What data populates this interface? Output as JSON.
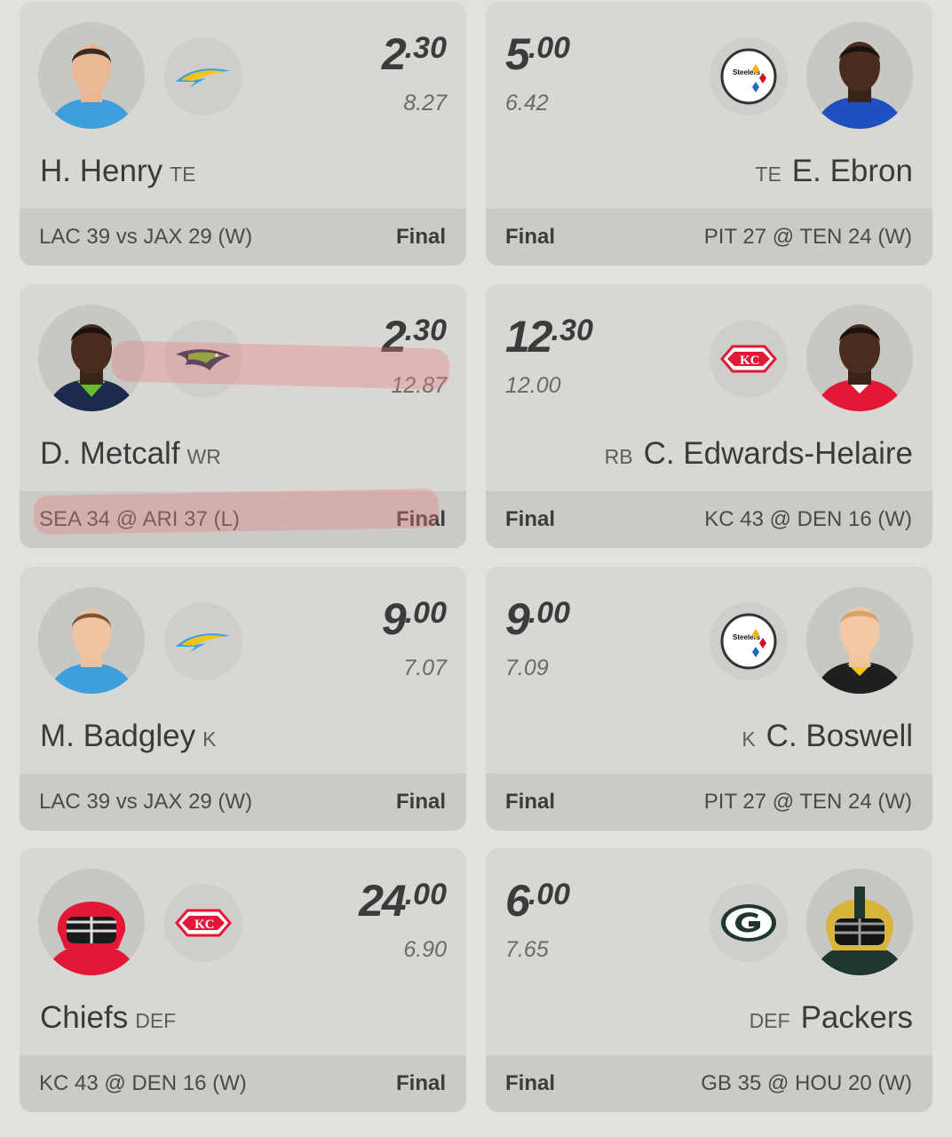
{
  "cards": [
    {
      "points_int": "2",
      "points_dec": ".30",
      "projection": "8.27",
      "name": "H. Henry",
      "position": "TE",
      "result": "LAC 39 vs JAX 29 (W)",
      "status": "Final",
      "team_logo": "chargers-logo",
      "avatar": "player-photo"
    },
    {
      "points_int": "5",
      "points_dec": ".00",
      "projection": "6.42",
      "name": "E. Ebron",
      "position": "TE",
      "result": "PIT 27 @ TEN 24 (W)",
      "status": "Final",
      "team_logo": "steelers-logo",
      "avatar": "player-photo"
    },
    {
      "points_int": "2",
      "points_dec": ".30",
      "projection": "12.87",
      "name": "D. Metcalf",
      "position": "WR",
      "result": "SEA 34 @ ARI 37 (L)",
      "status": "Final",
      "team_logo": "seahawks-logo",
      "avatar": "player-photo"
    },
    {
      "points_int": "12",
      "points_dec": ".30",
      "projection": "12.00",
      "name": "C. Edwards-Helaire",
      "position": "RB",
      "result": "KC 43 @ DEN 16 (W)",
      "status": "Final",
      "team_logo": "chiefs-logo",
      "avatar": "player-photo"
    },
    {
      "points_int": "9",
      "points_dec": ".00",
      "projection": "7.07",
      "name": "M. Badgley",
      "position": "K",
      "result": "LAC 39 vs JAX 29 (W)",
      "status": "Final",
      "team_logo": "chargers-logo",
      "avatar": "player-photo"
    },
    {
      "points_int": "9",
      "points_dec": ".00",
      "projection": "7.09",
      "name": "C. Boswell",
      "position": "K",
      "result": "PIT 27 @ TEN 24 (W)",
      "status": "Final",
      "team_logo": "steelers-logo",
      "avatar": "player-photo"
    },
    {
      "points_int": "24",
      "points_dec": ".00",
      "projection": "6.90",
      "name": "Chiefs",
      "position": "DEF",
      "result": "KC 43 @ DEN 16 (W)",
      "status": "Final",
      "team_logo": "chiefs-logo",
      "avatar": "helmet-photo"
    },
    {
      "points_int": "6",
      "points_dec": ".00",
      "projection": "7.65",
      "name": "Packers",
      "position": "DEF",
      "result": "GB 35 @ HOU 20 (W)",
      "status": "Final",
      "team_logo": "packers-logo",
      "avatar": "helmet-photo"
    }
  ],
  "colors": {
    "page_bg": "#e2e1dd",
    "card_bg": "#d8d7d3",
    "footer_bg": "#cacac6",
    "highlight": "#e8787d",
    "chargers_blue": "#3aa0e0",
    "chargers_gold": "#f2c318",
    "chiefs_red": "#e31837",
    "packers_green": "#203731",
    "seahawks_navy": "#1b2a4e"
  }
}
